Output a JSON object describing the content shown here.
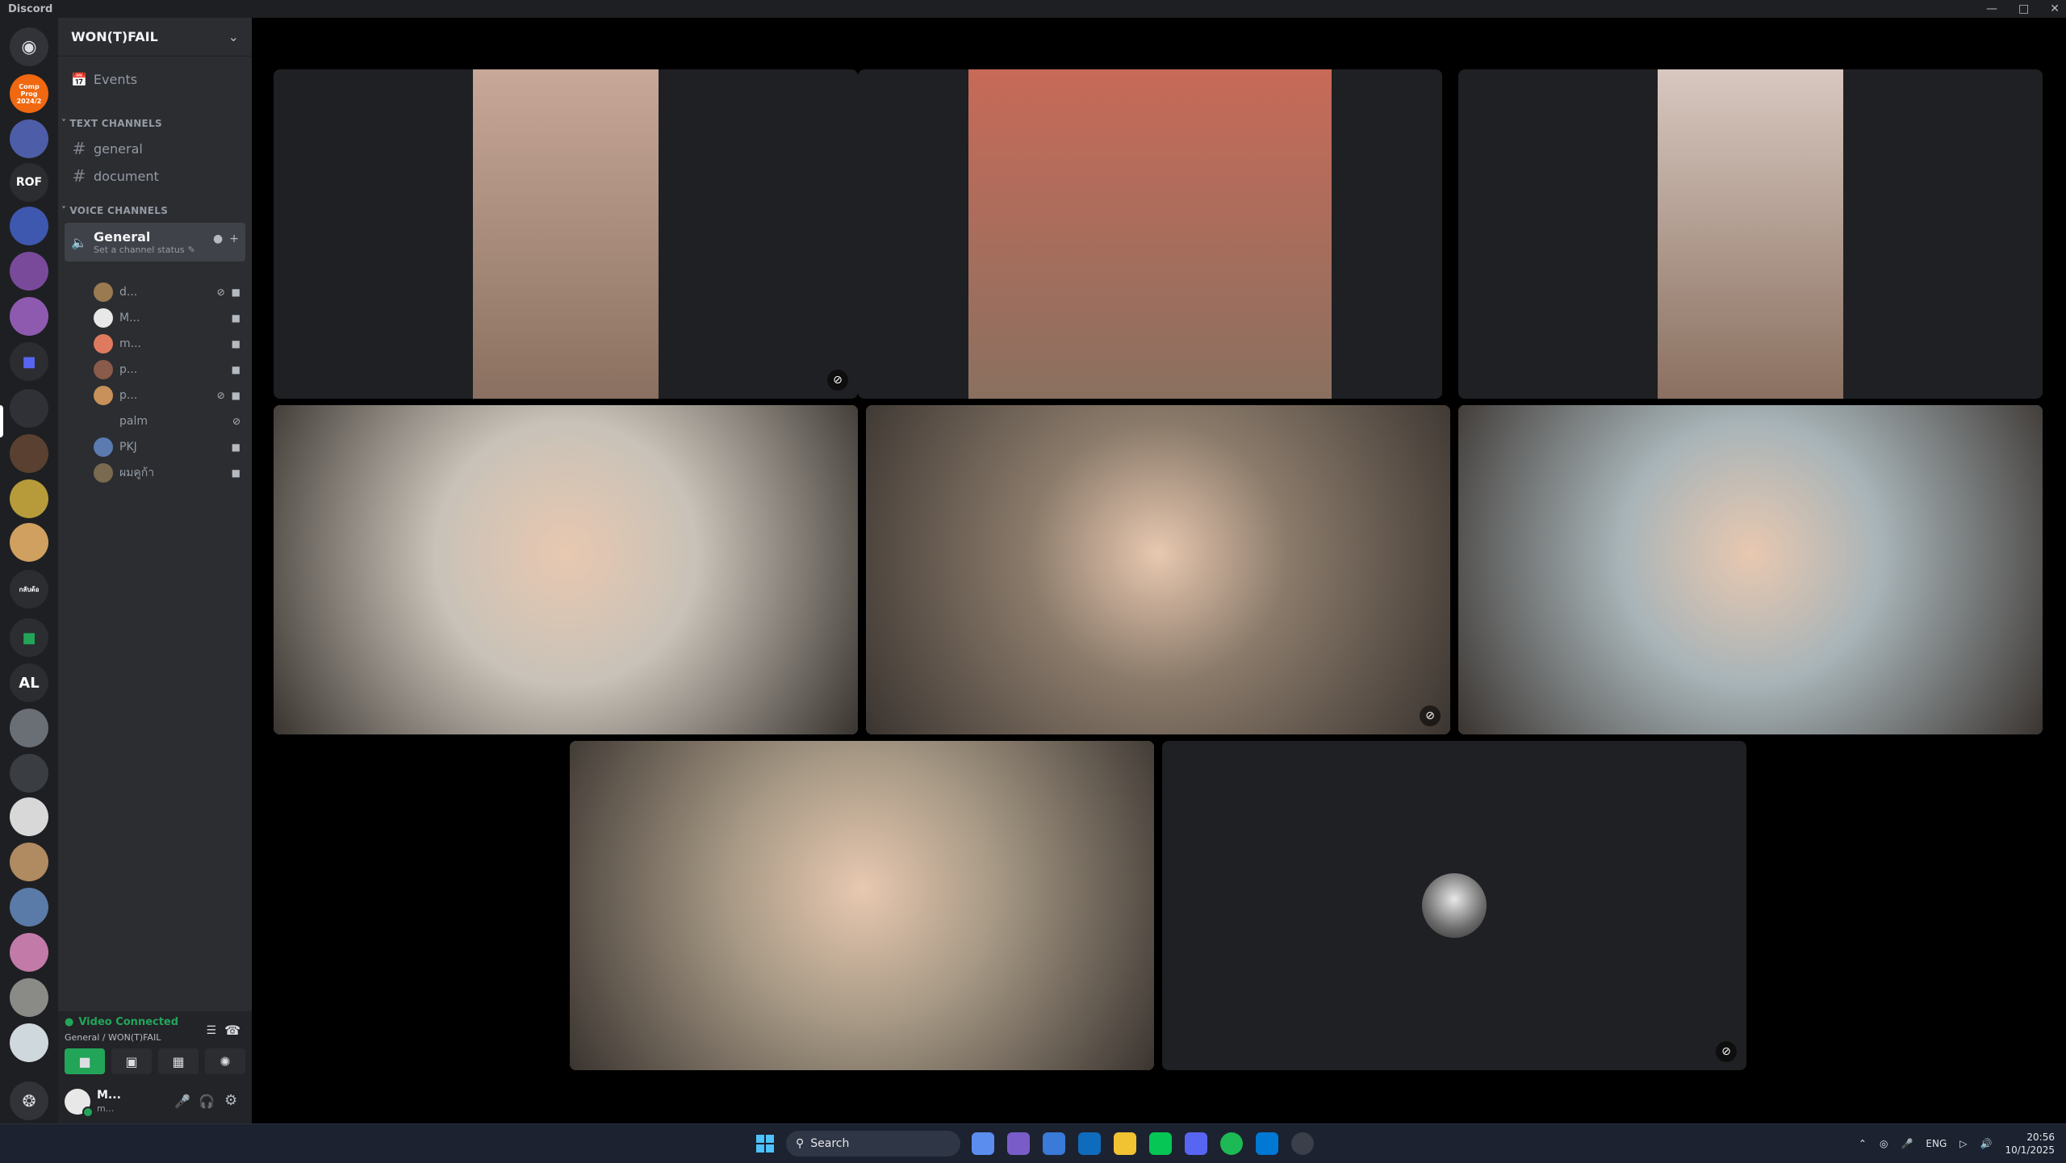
{
  "window": {
    "app_name": "Discord"
  },
  "rail": {
    "servers": [
      {
        "name": "discord-home",
        "label": "",
        "color": "#313338"
      },
      {
        "name": "server-comp-prog",
        "label": "Comp Prog 2024/2",
        "color": "#f0680f"
      },
      {
        "name": "server-2",
        "label": "",
        "color": "#4e5da8"
      },
      {
        "name": "server-rof",
        "label": "ROF",
        "color": "#2b2d31"
      },
      {
        "name": "server-4",
        "label": "",
        "color": "#3e58b0"
      },
      {
        "name": "server-5",
        "label": "",
        "color": "#7a4a9a"
      },
      {
        "name": "server-6",
        "label": "",
        "color": "#8e5ab0"
      },
      {
        "name": "folder-1",
        "label": "",
        "color": "#2b2d31"
      },
      {
        "name": "server-wof",
        "label": "",
        "color": "#2f3136"
      },
      {
        "name": "server-9",
        "label": "",
        "color": "#5a4030"
      },
      {
        "name": "server-10",
        "label": "",
        "color": "#b79b3a"
      },
      {
        "name": "server-11",
        "label": "",
        "color": "#d0a060"
      },
      {
        "name": "server-12",
        "label": "กลับด้อ",
        "color": "#2b2d31"
      },
      {
        "name": "folder-2",
        "label": "",
        "color": "#2b2d31"
      },
      {
        "name": "server-al",
        "label": "AL",
        "color": "#2b2d31"
      },
      {
        "name": "server-15",
        "label": "",
        "color": "#6a6f76"
      },
      {
        "name": "server-16",
        "label": "",
        "color": "#3a3d42"
      },
      {
        "name": "server-17",
        "label": "",
        "color": "#d8d8d8"
      },
      {
        "name": "server-18",
        "label": "",
        "color": "#b08a60"
      },
      {
        "name": "server-19",
        "label": "",
        "color": "#5a7aa8"
      },
      {
        "name": "server-20",
        "label": "",
        "color": "#c27aa8"
      },
      {
        "name": "server-21",
        "label": "",
        "color": "#8a8a86"
      },
      {
        "name": "server-22",
        "label": "",
        "color": "#cfd8dc"
      }
    ]
  },
  "guild": {
    "name": "WON(T)FAIL",
    "events_label": "Events",
    "text_category": "TEXT CHANNELS",
    "text_channels": [
      "general",
      "document"
    ],
    "voice_category": "VOICE CHANNELS",
    "voice_channel": {
      "name": "General",
      "status": "Set a channel status"
    },
    "members": [
      {
        "name": "d...",
        "color": "#9a7a50",
        "muted": true
      },
      {
        "name": "M...",
        "color": "#e8e8e8",
        "muted": false
      },
      {
        "name": "m...",
        "color": "#e07a5f",
        "muted": false
      },
      {
        "name": "p...",
        "color": "#8a5a4a",
        "muted": false
      },
      {
        "name": "p...",
        "color": "#c8905a",
        "muted": true
      },
      {
        "name": "palm",
        "color": "#2b2d31",
        "muted": true
      },
      {
        "name": "PKJ",
        "color": "#5a7ab0",
        "muted": false
      },
      {
        "name": "ผมคูก้า",
        "color": "#7a6a50",
        "muted": false
      }
    ]
  },
  "voice_panel": {
    "status": "Video Connected",
    "location": "General / WON(T)FAIL",
    "status_color": "#23a559"
  },
  "user": {
    "name": "M...",
    "tag": "m..."
  },
  "tiles": [
    {
      "name": "tile-1",
      "bg": "#1f2023",
      "face": "#c8a898",
      "muted": true
    },
    {
      "name": "tile-2",
      "bg": "#1f2023",
      "face": "#c86a58",
      "muted": false
    },
    {
      "name": "tile-3",
      "bg": "#1f2023",
      "face": "#d8c8c0",
      "muted": false
    },
    {
      "name": "tile-4",
      "bg": "#c8c2b8",
      "face": null,
      "muted": false
    },
    {
      "name": "tile-5",
      "bg": "#8a7a6a",
      "face": null,
      "muted": true
    },
    {
      "name": "tile-6",
      "bg": "#a8b4b8",
      "face": null,
      "muted": false
    },
    {
      "name": "tile-7",
      "bg": "#a89a86",
      "face": null,
      "muted": false
    },
    {
      "name": "tile-8",
      "bg": "#1f2023",
      "face": null,
      "muted": true
    }
  ],
  "taskbar": {
    "search_label": "Search",
    "lang": "ENG",
    "time": "20:56",
    "date": "10/1/2025"
  }
}
